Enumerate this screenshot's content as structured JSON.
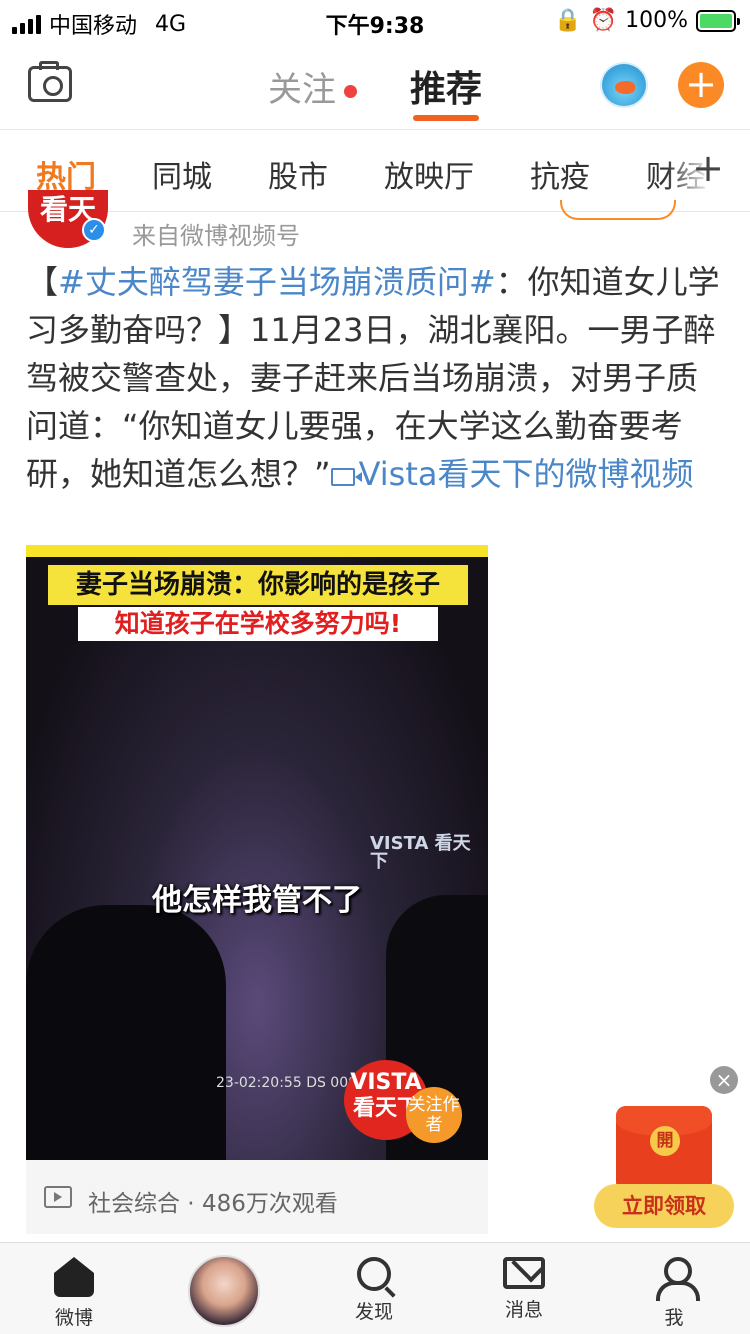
{
  "status_bar": {
    "carrier": "中国移动",
    "network": "4G",
    "time": "下午9:38",
    "battery": "100%"
  },
  "top_nav": {
    "follow_tab": "关注",
    "recommend_tab": "推荐",
    "accent": "#f06220"
  },
  "channels": [
    "热门",
    "同城",
    "股市",
    "放映厅",
    "抗疫",
    "财经"
  ],
  "post": {
    "author_avatar_text": "看天",
    "source": "来自微博视频号",
    "text_prefix": "【",
    "topic": "#丈夫醉驾妻子当场崩溃质问#",
    "text_body": "：你知道女儿学习多勤奋吗？】11月23日，湖北襄阳。一男子醉驾被交警查处，妻子赶来后当场崩溃，对男子质问道：“你知道女儿要强，在大学这么勤奋要考研，她知道怎么想？”",
    "video_link": "Vista看天下的微博视频"
  },
  "video": {
    "caption1": "妻子当场崩溃：你影响的是孩子",
    "caption2": "知道孩子在学校多努力吗!",
    "subtitle": "他怎样我管不了",
    "watermark": "VISTA 看天下",
    "timestamp": "23-02:20:55 DS 000000",
    "logo_text": "VISTA 看天下",
    "follow_author": "关注作者"
  },
  "video_info": {
    "category": "社会综合",
    "separator": " · ",
    "views": "486万次观看"
  },
  "ad": {
    "close": "×",
    "open_label": "開",
    "claim": "立即领取"
  },
  "tab_bar": {
    "home": "微博",
    "discover": "发现",
    "messages": "消息",
    "me": "我"
  }
}
